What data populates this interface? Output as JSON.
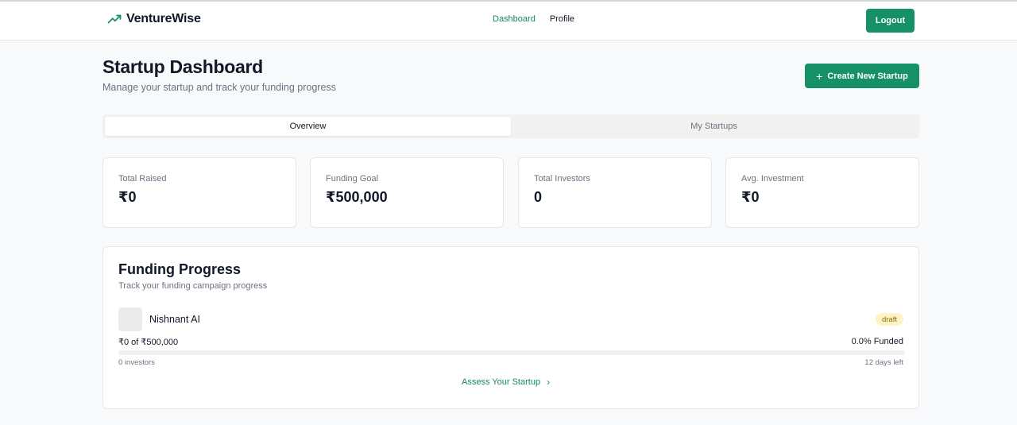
{
  "app": {
    "name": "VentureWise"
  },
  "nav": {
    "dashboard": "Dashboard",
    "profile": "Profile",
    "logout": "Logout"
  },
  "page": {
    "title": "Startup Dashboard",
    "subtitle": "Manage your startup and track your funding progress",
    "create_button": "Create New Startup"
  },
  "tabs": [
    {
      "label": "Overview",
      "active": true
    },
    {
      "label": "My Startups",
      "active": false
    }
  ],
  "stats": [
    {
      "label": "Total Raised",
      "value": "₹0"
    },
    {
      "label": "Funding Goal",
      "value": "₹500,000"
    },
    {
      "label": "Total Investors",
      "value": "0"
    },
    {
      "label": "Avg. Investment",
      "value": "₹0"
    }
  ],
  "funding": {
    "title": "Funding Progress",
    "subtitle": "Track your funding campaign progress",
    "startup": {
      "name": "Nishnant AI",
      "status": "draft",
      "raised_text": "₹0 of ₹500,000",
      "funded_text": "0.0% Funded",
      "progress_fraction": 0.0,
      "investors_text": "0 investors",
      "days_left_text": "12 days left"
    },
    "assess_link": "Assess Your Startup"
  },
  "icons": {
    "brand": "trending-up-icon",
    "create": "plus-icon",
    "assess": "chevron-right-icon"
  },
  "colors": {
    "accent": "#159067",
    "badge_bg": "#fdf3c4",
    "badge_text": "#8a6a0b"
  }
}
